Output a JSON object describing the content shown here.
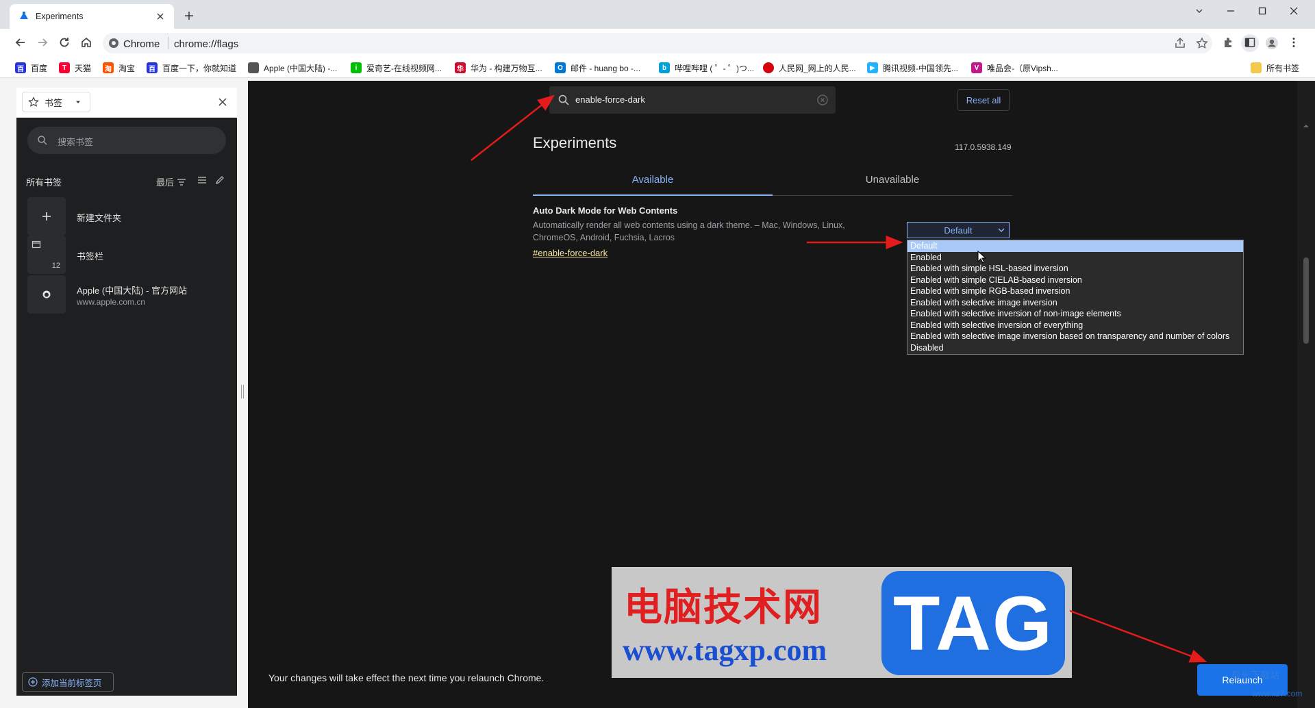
{
  "browser": {
    "tab_title": "Experiments",
    "site_label": "Chrome",
    "url": "chrome://flags"
  },
  "bookmarks_bar": [
    {
      "label": "百度",
      "icon": "baidu-icon",
      "color": "#2932e1"
    },
    {
      "label": "天猫",
      "icon": "tmall-icon",
      "color": "#ff0036"
    },
    {
      "label": "淘宝",
      "icon": "taobao-icon",
      "color": "#ff5000"
    },
    {
      "label": "百度一下，你就知道",
      "icon": "baidu-icon",
      "color": "#2932e1"
    },
    {
      "label": "Apple (中国大陆) -...",
      "icon": "apple-icon",
      "color": "#555555"
    },
    {
      "label": "爱奇艺-在线视频网...",
      "icon": "iqiyi-icon",
      "color": "#00be06"
    },
    {
      "label": "华为 - 构建万物互...",
      "icon": "huawei-icon",
      "color": "#cf0a2c"
    },
    {
      "label": "邮件 - huang bo -...",
      "icon": "outlook-icon",
      "color": "#0078d4"
    },
    {
      "label": "哔哩哔哩 ( ゜- ゜)つ...",
      "icon": "bilibili-icon",
      "color": "#00a1d6"
    },
    {
      "label": "人民网_网上的人民...",
      "icon": "people-icon",
      "color": "#d7000f"
    },
    {
      "label": "腾讯视频-中国领先...",
      "icon": "tencent-video-icon",
      "color": "#20b4ff"
    },
    {
      "label": "唯品会-（原Vipsh...",
      "icon": "vip-icon",
      "color": "#c1188a"
    }
  ],
  "bookmarks_bar_all": "所有书签",
  "side_panel": {
    "selector_label": "书签",
    "search_placeholder": "搜索书签",
    "all_bookmarks": "所有书签",
    "sort_label": "最后",
    "items": [
      {
        "label": "新建文件夹",
        "sub": "",
        "badge": ""
      },
      {
        "label": "书签栏",
        "sub": "",
        "badge": "12"
      },
      {
        "label": "Apple (中国大陆) - 官方网站",
        "sub": "www.apple.com.cn",
        "badge": ""
      }
    ],
    "add_current": "添加当前标签页"
  },
  "flags": {
    "search_value": "enable-force-dark",
    "reset_all": "Reset all",
    "title": "Experiments",
    "version": "117.0.5938.149",
    "tabs": [
      "Available",
      "Unavailable"
    ],
    "experiment": {
      "name": "Auto Dark Mode for Web Contents",
      "description": "Automatically render all web contents using a dark theme. – Mac, Windows, Linux, ChromeOS, Android, Fuchsia, Lacros",
      "link": "#enable-force-dark",
      "selected": "Default",
      "options": [
        "Default",
        "Enabled",
        "Enabled with simple HSL-based inversion",
        "Enabled with simple CIELAB-based inversion",
        "Enabled with simple RGB-based inversion",
        "Enabled with selective image inversion",
        "Enabled with selective inversion of non-image elements",
        "Enabled with selective inversion of everything",
        "Enabled with selective image inversion based on transparency and number of colors",
        "Disabled"
      ]
    },
    "relaunch_message": "Your changes will take effect the next time you relaunch Chrome.",
    "relaunch_button": "Relaunch"
  },
  "watermark": {
    "cn_text": "电脑技术网",
    "url": "www.tagxp.com",
    "tag": "TAG",
    "corner_text": "极光下载站",
    "corner_url": "www.xz7.com"
  },
  "colors": {
    "accent": "#8ab4f8",
    "page_bg": "#161616",
    "relaunch_bg": "#1a73e8",
    "annotation_arrow": "#e41b1b"
  }
}
